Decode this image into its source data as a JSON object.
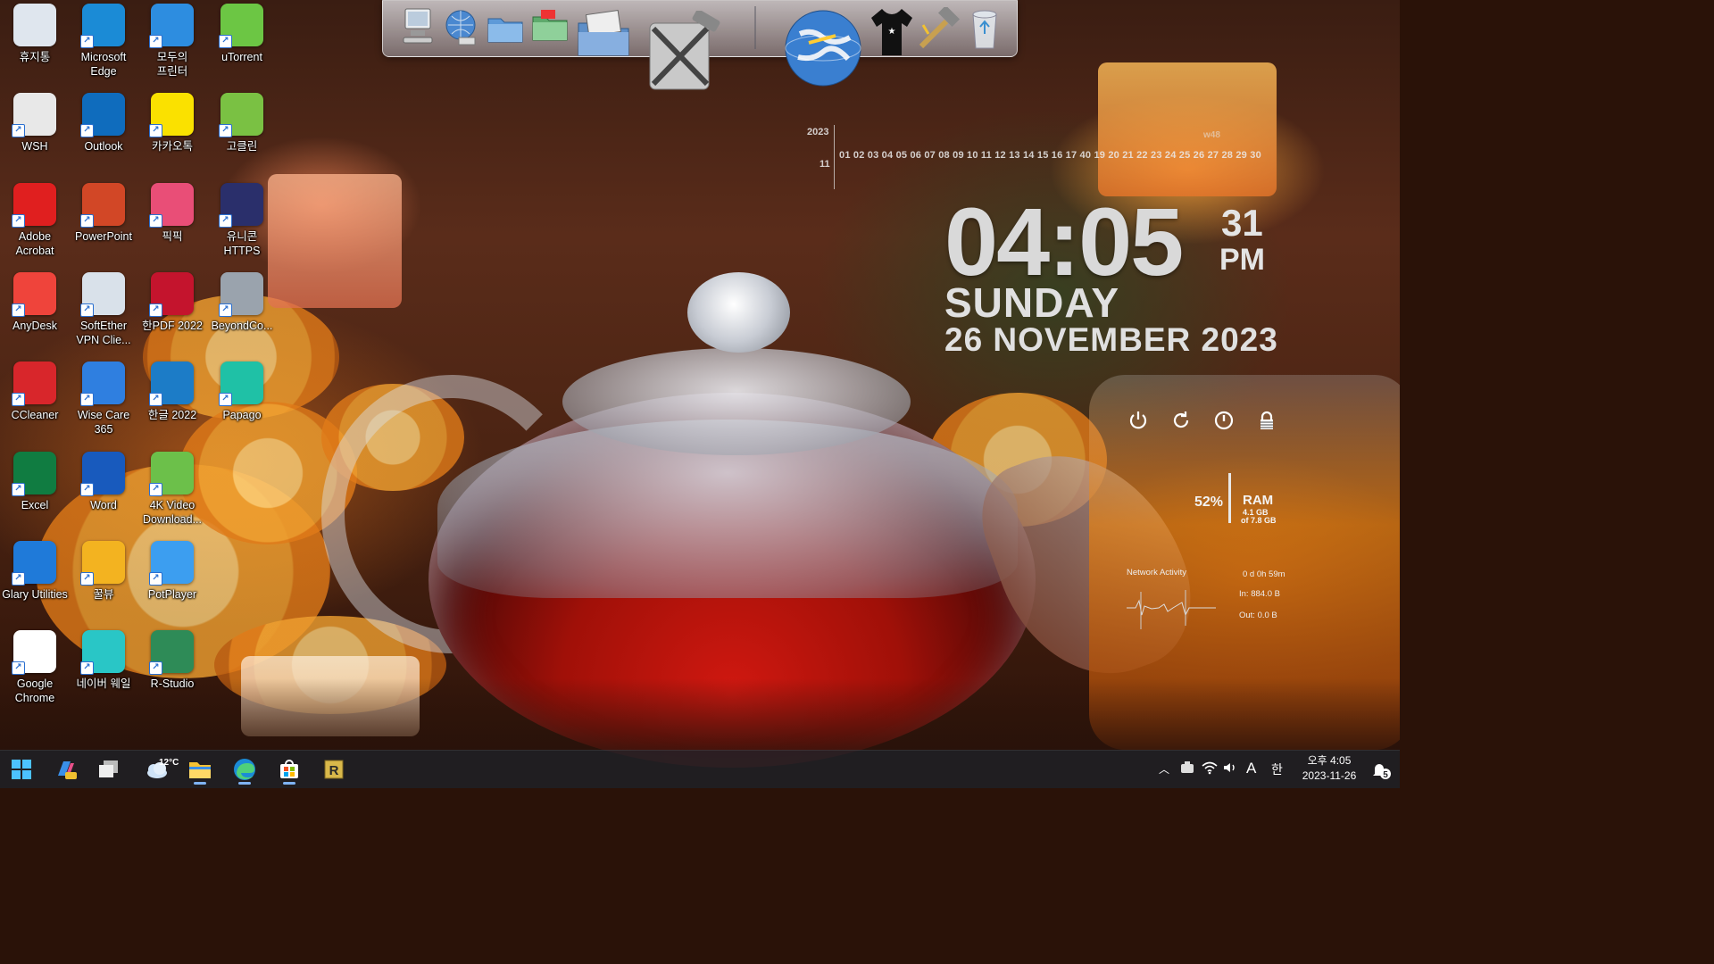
{
  "desktop": {
    "icons": [
      {
        "label": "휴지통",
        "icon": "recycle-bin-icon",
        "color": "#dfe6ee"
      },
      {
        "label": "Microsoft\nEdge",
        "icon": "edge-icon",
        "color": "#1b8bd6"
      },
      {
        "label": "모두의\n프린터",
        "icon": "printer-icon",
        "color": "#2d8de0"
      },
      {
        "label": "uTorrent",
        "icon": "utorrent-icon",
        "color": "#6cc644"
      },
      {
        "label": "WSH",
        "icon": "document-icon",
        "color": "#e8e8e8"
      },
      {
        "label": "Outlook",
        "icon": "outlook-icon",
        "color": "#0f6cbd"
      },
      {
        "label": "카카오톡",
        "icon": "kakaotalk-icon",
        "color": "#fae100"
      },
      {
        "label": "고클린",
        "icon": "goclean-icon",
        "color": "#7ac143"
      },
      {
        "label": "Adobe\nAcrobat",
        "icon": "acrobat-icon",
        "color": "#e01f1f"
      },
      {
        "label": "PowerPoint",
        "icon": "powerpoint-icon",
        "color": "#d24726"
      },
      {
        "label": "픽픽",
        "icon": "picpick-icon",
        "color": "#e94e77"
      },
      {
        "label": "유니콘\nHTTPS",
        "icon": "unicorn-https-icon",
        "color": "#2a2f6b"
      },
      {
        "label": "AnyDesk",
        "icon": "anydesk-icon",
        "color": "#ef443b"
      },
      {
        "label": "SoftEther\nVPN Clie...",
        "icon": "softether-icon",
        "color": "#d9e1ea"
      },
      {
        "label": "한PDF 2022",
        "icon": "hanpdf-icon",
        "color": "#c4142d"
      },
      {
        "label": "BeyondCo...",
        "icon": "beyondcompare-icon",
        "color": "#9aa3ad"
      },
      {
        "label": "CCleaner",
        "icon": "ccleaner-icon",
        "color": "#d8262b"
      },
      {
        "label": "Wise Care\n365",
        "icon": "wisecare-icon",
        "color": "#2f7fe0"
      },
      {
        "label": "한글 2022",
        "icon": "hangul-icon",
        "color": "#1c7cc7"
      },
      {
        "label": "Papago",
        "icon": "papago-icon",
        "color": "#1fc1a6"
      },
      {
        "label": "Excel",
        "icon": "excel-icon",
        "color": "#107c41"
      },
      {
        "label": "Word",
        "icon": "word-icon",
        "color": "#185abd"
      },
      {
        "label": "4K Video\nDownload...",
        "icon": "4kvideo-icon",
        "color": "#6cc04a"
      },
      {
        "label": "",
        "icon": "blank-icon",
        "color": "transparent"
      },
      {
        "label": "Glary Utilities",
        "icon": "glary-icon",
        "color": "#1f7ad9"
      },
      {
        "label": "꿀뷰",
        "icon": "honeyview-icon",
        "color": "#f3b320"
      },
      {
        "label": "PotPlayer",
        "icon": "potplayer-icon",
        "color": "#3c9ef0"
      },
      {
        "label": "",
        "icon": "blank-icon",
        "color": "transparent"
      },
      {
        "label": "Google\nChrome",
        "icon": "chrome-icon",
        "color": "#ffffff"
      },
      {
        "label": "네이버 웨일",
        "icon": "whale-icon",
        "color": "#29c6c6"
      },
      {
        "label": "R-Studio",
        "icon": "rstudio-icon",
        "color": "#2e8b57"
      }
    ]
  },
  "dock": {
    "items": [
      "computer-icon",
      "network-globe-icon",
      "folder-icon",
      "green-folder-icon",
      "photo-folder-icon",
      "system-tools-icon",
      "world-globe-icon",
      "tshirt-icon",
      "hammer-icon",
      "trash-icon"
    ]
  },
  "calendar": {
    "year": "2023",
    "month": "11",
    "week": "w48",
    "days": "01 02 03 04 05 06 07 08 09 10 11 12 13 14 15 16 17 40 19 20 21 22 23 24 25 26 27 28 29 30"
  },
  "clock": {
    "time": "04:05",
    "seconds": "31",
    "ampm": "PM",
    "day": "SUNDAY",
    "date": "26 NOVEMBER  2023"
  },
  "system": {
    "power_buttons": [
      "power-icon",
      "restart-icon",
      "shutdown-icon",
      "lock-icon"
    ],
    "ram_percent": "52%",
    "ram_label": "RAM",
    "ram_used": "4.1 GB",
    "ram_total": "of 7.8 GB",
    "network_title": "Network Activity",
    "uptime": "0 d 0h 59m",
    "net_in": "In: 884.0 B",
    "net_out": "Out: 0.0 B"
  },
  "taskbar": {
    "weather_temp": "12°C",
    "items": [
      "start-icon",
      "copilot-icon",
      "task-view-icon",
      "weather-icon",
      "file-explorer-icon",
      "edge-icon",
      "store-icon",
      "rstudio-icon"
    ],
    "ime_mode": "A",
    "ime_lang": "한",
    "time": "오후 4:05",
    "date": "2023-11-26",
    "notifications": "5"
  },
  "colors": {
    "taskbar_bg": "#202024",
    "accent": "#7fb4f5",
    "clock_text": "#d9d9d9"
  }
}
